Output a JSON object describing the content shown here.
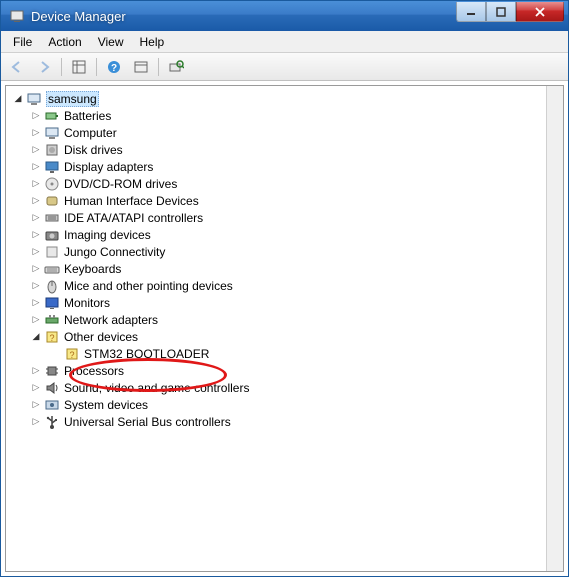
{
  "window": {
    "title": "Device Manager"
  },
  "menubar": {
    "items": [
      "File",
      "Action",
      "View",
      "Help"
    ]
  },
  "toolbar": {
    "back": "back-icon",
    "forward": "forward-icon",
    "detail": "detail-icon",
    "help": "help-icon",
    "showhidden": "showhidden-icon",
    "scan": "scan-icon"
  },
  "tree": {
    "root": {
      "label": "samsung",
      "expanded": true,
      "selected": true
    },
    "categories": [
      {
        "label": "Batteries",
        "icon": "battery"
      },
      {
        "label": "Computer",
        "icon": "computer"
      },
      {
        "label": "Disk drives",
        "icon": "disk"
      },
      {
        "label": "Display adapters",
        "icon": "display"
      },
      {
        "label": "DVD/CD-ROM drives",
        "icon": "cdrom"
      },
      {
        "label": "Human Interface Devices",
        "icon": "hid"
      },
      {
        "label": "IDE ATA/ATAPI controllers",
        "icon": "ide"
      },
      {
        "label": "Imaging devices",
        "icon": "imaging"
      },
      {
        "label": "Jungo Connectivity",
        "icon": "generic"
      },
      {
        "label": "Keyboards",
        "icon": "keyboard"
      },
      {
        "label": "Mice and other pointing devices",
        "icon": "mouse"
      },
      {
        "label": "Monitors",
        "icon": "monitor"
      },
      {
        "label": "Network adapters",
        "icon": "network"
      },
      {
        "label": "Other devices",
        "icon": "other",
        "expanded": true,
        "children": [
          {
            "label": "STM32  BOOTLOADER",
            "icon": "unknown",
            "circled": true
          }
        ]
      },
      {
        "label": "Processors",
        "icon": "cpu"
      },
      {
        "label": "Sound, video and game controllers",
        "icon": "sound"
      },
      {
        "label": "System devices",
        "icon": "system"
      },
      {
        "label": "Universal Serial Bus controllers",
        "icon": "usb"
      }
    ]
  }
}
